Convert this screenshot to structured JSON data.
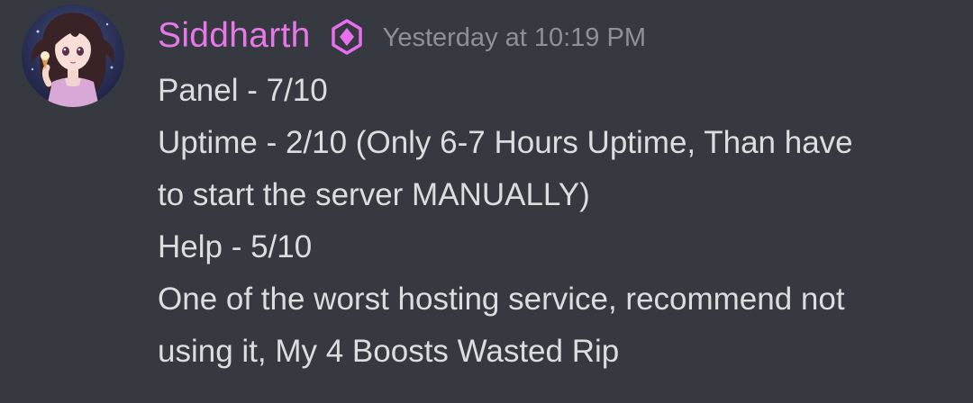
{
  "message": {
    "author": {
      "name": "Siddharth",
      "name_color": "#e878e9",
      "role_badge_icon": "boost-hexagon-icon",
      "role_badge_color": "#e86ff0"
    },
    "timestamp": "Yesterday at 10:19 PM",
    "lines": [
      "Panel - 7/10",
      "Uptime - 2/10 (Only 6-7 Hours Uptime, Than have",
      "to start the server MANUALLY)",
      "Help - 5/10",
      "One of the worst hosting service, recommend not",
      "using it, My 4 Boosts Wasted Rip"
    ]
  },
  "theme": {
    "background": "#36393f",
    "text": "#dcddde",
    "muted": "#8e9297"
  }
}
